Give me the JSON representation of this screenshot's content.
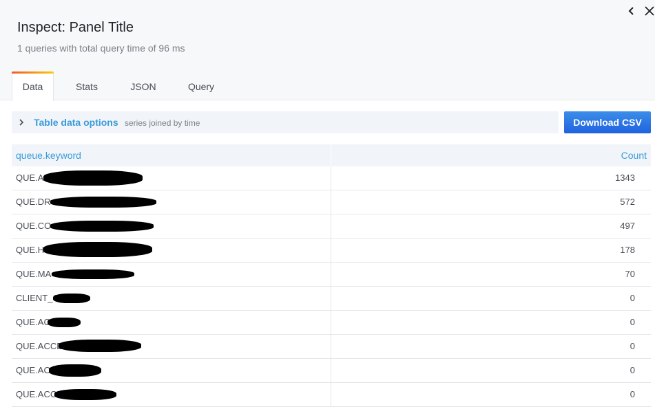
{
  "header": {
    "title": "Inspect: Panel Title",
    "subtitle": "1 queries with total query time of 96 ms",
    "back_icon": "chevron-left-icon",
    "close_icon": "close-icon"
  },
  "tabs": [
    {
      "label": "Data",
      "active": true
    },
    {
      "label": "Stats",
      "active": false
    },
    {
      "label": "JSON",
      "active": false
    },
    {
      "label": "Query",
      "active": false
    }
  ],
  "options": {
    "title": "Table data options",
    "description": "series joined by time",
    "icon": "chevron-right-icon"
  },
  "download": {
    "label": "Download CSV"
  },
  "table": {
    "columns": [
      "queue.keyword",
      "Count"
    ],
    "rows": [
      {
        "name": "QUE.AC",
        "count": "1343"
      },
      {
        "name": "QUE.DR",
        "count": "572"
      },
      {
        "name": "QUE.CO",
        "count": "497"
      },
      {
        "name": "QUE.H",
        "count": "178"
      },
      {
        "name": "QUE.MA",
        "count": "70"
      },
      {
        "name": "CLIENT_C",
        "count": "0"
      },
      {
        "name": "QUE.AC",
        "count": "0"
      },
      {
        "name": "QUE.ACCE",
        "count": "0"
      },
      {
        "name": "QUE.AC",
        "count": "0"
      },
      {
        "name": "QUE.ACC",
        "count": "0"
      }
    ]
  },
  "colors": {
    "accent": "#3b9ad9",
    "button": "#1f62e0",
    "tab_highlight": "#f05a28"
  }
}
